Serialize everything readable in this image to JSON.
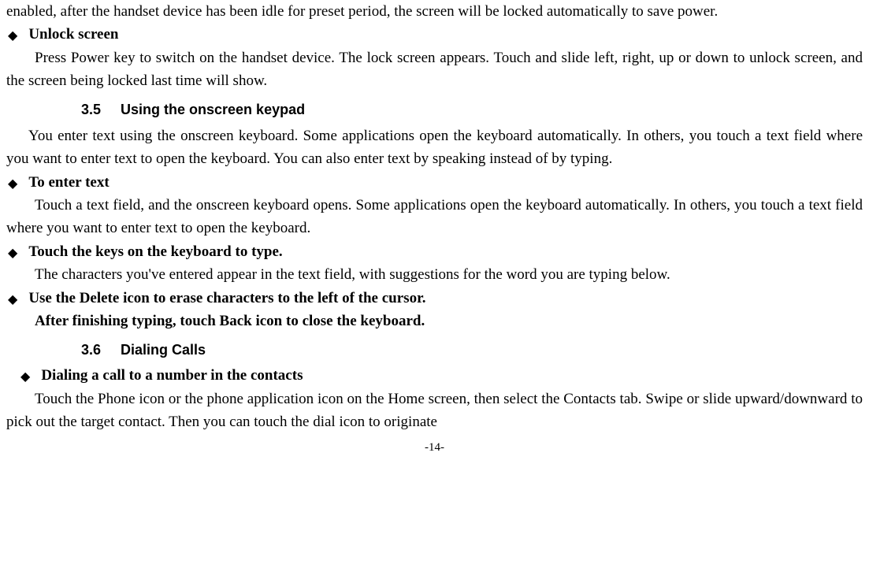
{
  "p1": "enabled, after the handset device has been idle for preset period, the screen will be locked automatically to save power.",
  "b_unlock": "Unlock screen",
  "p_unlock": "Press Power key to switch on the handset device. The lock screen appears. Touch and slide left, right, up or down to unlock screen, and the screen being locked last time will show.",
  "h35_num": "3.5",
  "h35_title": "Using the onscreen keypad",
  "p_h35": "You enter text using the onscreen keyboard. Some applications open the keyboard automatically. In others, you touch a text field where you want to enter text to open the keyboard. You can also enter text by speaking instead of by typing.",
  "b_enter": "To enter text",
  "p_enter": "Touch a text field, and the onscreen keyboard opens. Some applications open the keyboard automatically. In others, you touch a text field where you want to enter text to open the keyboard.",
  "b_touchkeys": "Touch the keys on the keyboard to type.",
  "p_touchkeys": "The characters you've entered appear in the text field, with suggestions for the word you are typing below.",
  "b_delete": "Use the Delete icon to erase characters to the left of the cursor.",
  "p_after": "After finishing typing, touch Back icon to close the keyboard.",
  "h36_num": "3.6",
  "h36_title": "Dialing Calls",
  "b_dialing": "Dialing a call to a number in the contacts",
  "p_dialing": "Touch the Phone icon or the phone application icon on the Home screen, then select the Contacts tab. Swipe or slide upward/downward to pick out the target contact. Then you can touch the dial icon to originate",
  "page_number": "-14-"
}
